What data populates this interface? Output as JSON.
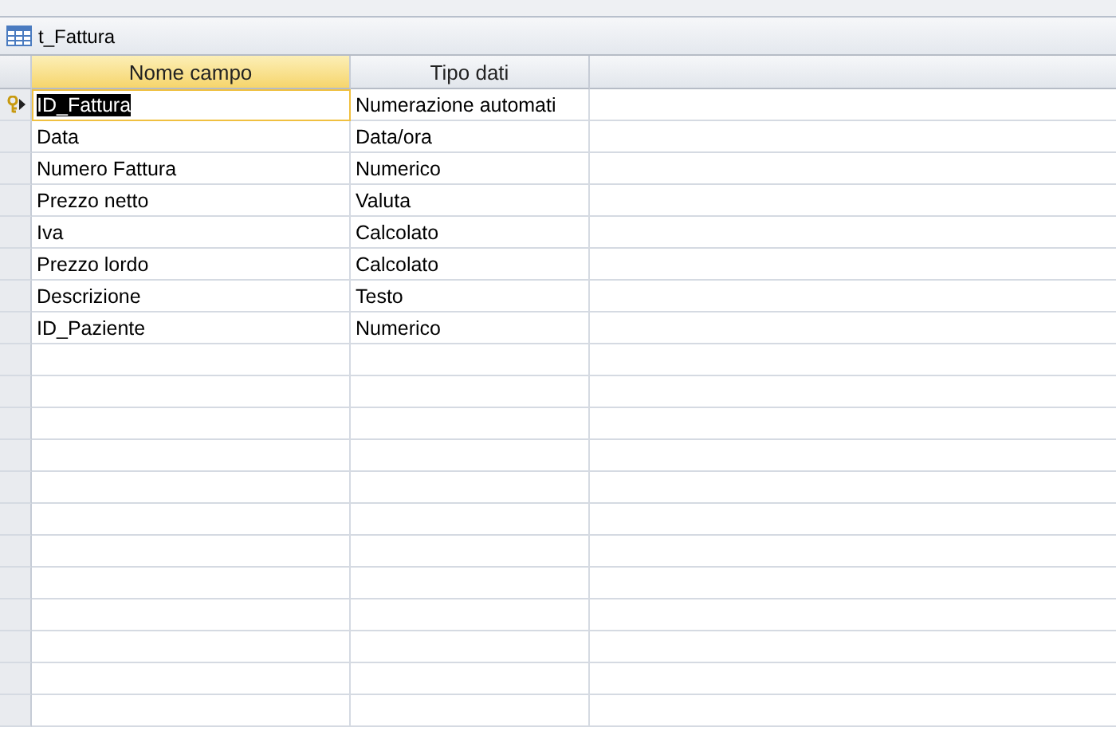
{
  "tab": {
    "title": "t_Fattura"
  },
  "columns": [
    {
      "label": "Nome campo",
      "selected": true
    },
    {
      "label": "Tipo dati",
      "selected": false
    }
  ],
  "rows": [
    {
      "name": "ID_Fattura",
      "type": "Numerazione automati",
      "primary_key": true,
      "current": true
    },
    {
      "name": "Data",
      "type": "Data/ora",
      "primary_key": false,
      "current": false
    },
    {
      "name": "Numero Fattura",
      "type": "Numerico",
      "primary_key": false,
      "current": false
    },
    {
      "name": "Prezzo netto",
      "type": "Valuta",
      "primary_key": false,
      "current": false
    },
    {
      "name": "Iva",
      "type": "Calcolato",
      "primary_key": false,
      "current": false
    },
    {
      "name": "Prezzo lordo",
      "type": "Calcolato",
      "primary_key": false,
      "current": false
    },
    {
      "name": "Descrizione",
      "type": "Testo",
      "primary_key": false,
      "current": false
    },
    {
      "name": "ID_Paziente",
      "type": "Numerico",
      "primary_key": false,
      "current": false
    }
  ]
}
